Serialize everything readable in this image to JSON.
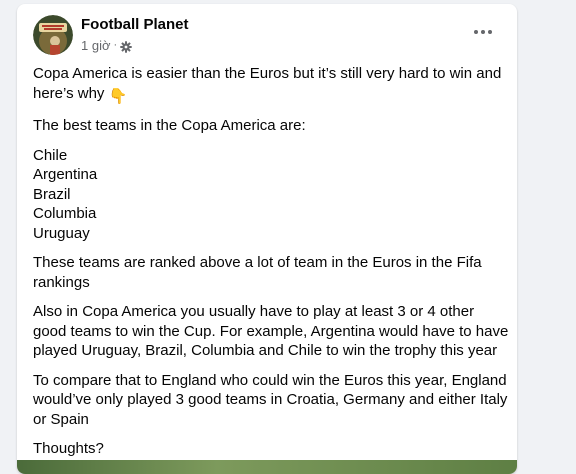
{
  "post": {
    "page_name": "Football Planet",
    "time": "1 giờ",
    "separator": "·",
    "privacy_icon": "gear-icon",
    "more_icon": "more-options-icon",
    "text": {
      "intro": "Copa America is easier than the Euros but it’s still very hard to win and here’s why",
      "intro_emoji": "👇",
      "teams_heading": "The best teams in the Copa America are:",
      "teams": [
        "Chile",
        "Argentina",
        "Brazil",
        "Columbia",
        "Uruguay"
      ],
      "ranking": "These teams are ranked above a lot of team in the Euros in the Fifa rankings",
      "path": "Also in Copa America you usually have to play at least 3  or 4 other good teams to win the Cup. For example, Argentina would have to have played Uruguay, Brazil, Columbia and Chile to win the trophy this year",
      "compare": "To compare that to England who could win the Euros this year, England would’ve only played 3 good teams in Croatia, Germany and either Italy or Spain",
      "closing": "Thoughts?"
    }
  },
  "colors": {
    "background": "#f0f2f5",
    "card": "#ffffff",
    "text": "#050505",
    "secondary_text": "#65676b"
  }
}
